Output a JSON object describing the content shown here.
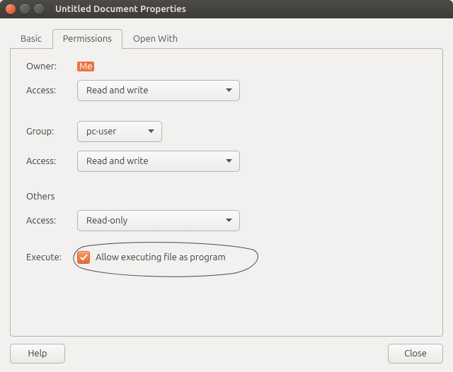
{
  "window": {
    "title": "Untitled Document Properties"
  },
  "tabs": {
    "basic": "Basic",
    "permissions": "Permissions",
    "open_with": "Open With"
  },
  "labels": {
    "owner": "Owner:",
    "access": "Access:",
    "group": "Group:",
    "others": "Others",
    "execute": "Execute:"
  },
  "owner": {
    "value": "Me",
    "access": "Read and write"
  },
  "group": {
    "value": "pc-user",
    "access": "Read and write"
  },
  "others": {
    "access": "Read-only"
  },
  "execute": {
    "checked": true,
    "label": "Allow executing file as program"
  },
  "buttons": {
    "help": "Help",
    "close": "Close"
  }
}
